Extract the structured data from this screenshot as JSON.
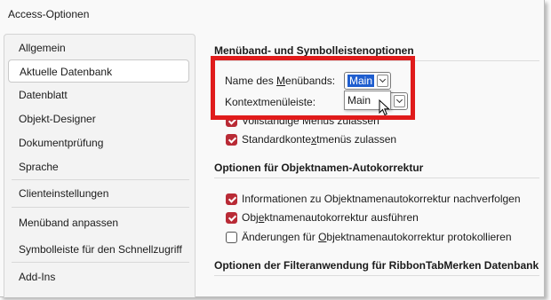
{
  "window": {
    "title": "Access-Optionen"
  },
  "sidebar": {
    "items": [
      {
        "label": "Allgemein"
      },
      {
        "label": "Aktuelle Datenbank"
      },
      {
        "label": "Datenblatt"
      },
      {
        "label": "Objekt-Designer"
      },
      {
        "label": "Dokumentprüfung"
      },
      {
        "label": "Sprache"
      },
      {
        "label": "Clienteinstellungen"
      },
      {
        "label": "Menüband anpassen"
      },
      {
        "label": "Symbolleiste für den Schnellzugriff"
      },
      {
        "label": "Add-Ins"
      }
    ],
    "selected": "Aktuelle Datenbank"
  },
  "ribbon_section": {
    "heading": "Menüband- und Symbolleistenoptionen",
    "ribbon_name_label_pre": "Name des ",
    "ribbon_name_label_u": "M",
    "ribbon_name_label_post": "enübands:",
    "ribbon_name_value": "Main",
    "context_menu_label": "Kontextmenüleiste:",
    "dropdown_option": "Main",
    "full_menus_label": "Vollständige Menüs zulassen",
    "full_menus_checked": true,
    "default_context_label_pre": "Standardkonte",
    "default_context_label_u": "x",
    "default_context_label_post": "tmenüs zulassen",
    "default_context_checked": true
  },
  "autocorrect_section": {
    "heading": "Optionen für Objektnamen-Autokorrektur",
    "track_label": "Informationen zu Objektnamenautokorrektur nachverfolgen",
    "track_checked": true,
    "perform_label_pre": "Obj",
    "perform_label_u": "e",
    "perform_label_post": "ktnamenautokorrektur ausführen",
    "perform_checked": true,
    "log_label_pre": "Änderungen für ",
    "log_label_u": "O",
    "log_label_post": "bjektnamenautokorrektur protokollieren",
    "log_checked": false
  },
  "filter_section": {
    "heading": "Optionen der Filteranwendung für RibbonTabMerken Datenbank"
  },
  "colors": {
    "accent_checkbox": "#b92b36",
    "highlight_box": "#e01b1b",
    "selection": "#1f5ecf"
  },
  "icons": [
    "checkmark-icon",
    "chevron-down-icon",
    "mouse-pointer-icon"
  ]
}
